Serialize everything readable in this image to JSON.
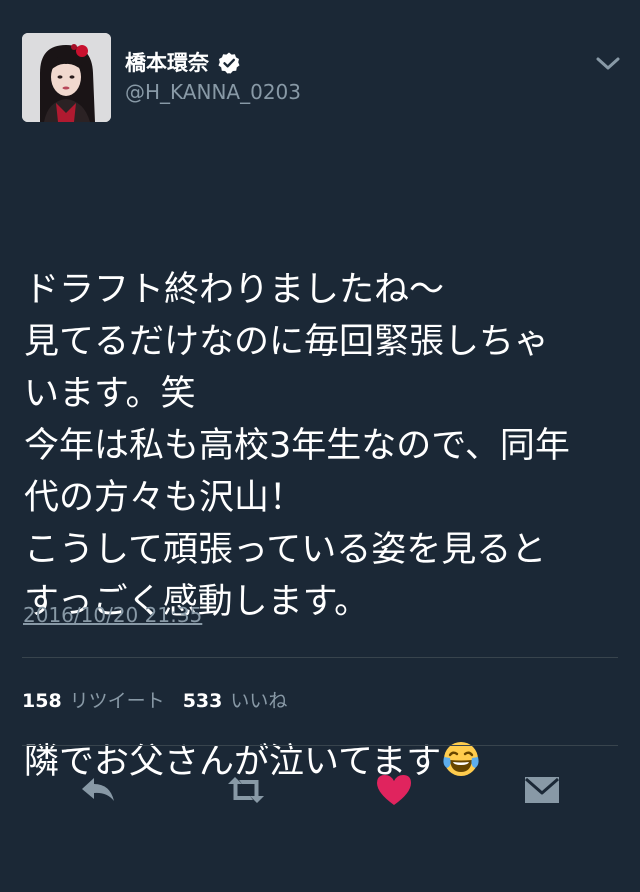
{
  "tweet": {
    "display_name": "橋本環奈",
    "handle": "@H_KANNA_0203",
    "verified": true,
    "text_paragraphs": [
      "ドラフト終わりましたね〜\n見てるだけなのに毎回緊張しちゃ\nいます。笑\n今年は私も高校3年生なので、同年\n代の方々も沢山！\nこうして頑張っている姿を見ると\nすっごく感動します。",
      "隣でお父さんが泣いてます"
    ],
    "emoji": "face-with-tears-of-joy",
    "timestamp": "2016/10/20 21:35",
    "retweet_count": "158",
    "retweet_label": "リツイート",
    "like_count": "533",
    "like_label": "いいね"
  },
  "colors": {
    "background": "#1b2836",
    "text": "#ffffff",
    "secondary": "#8899a6",
    "like": "#e0245e",
    "divider": "#38444d"
  },
  "icons": {
    "verified": "verified-badge-icon",
    "more": "chevron-down-icon",
    "reply": "reply-icon",
    "retweet": "retweet-icon",
    "like": "heart-icon",
    "dm": "envelope-icon"
  }
}
